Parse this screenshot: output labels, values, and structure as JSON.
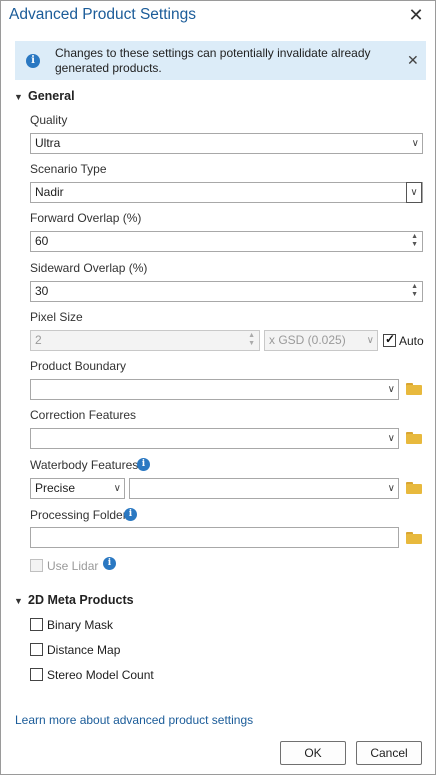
{
  "dialog": {
    "title": "Advanced Product Settings"
  },
  "banner": {
    "message": "Changes to these settings can potentially invalidate already generated products.",
    "icon": "info-icon"
  },
  "general": {
    "heading": "General",
    "quality": {
      "label": "Quality",
      "value": "Ultra"
    },
    "scenario": {
      "label": "Scenario Type",
      "value": "Nadir"
    },
    "forward_overlap": {
      "label": "Forward Overlap (%)",
      "value": "60"
    },
    "sideward_overlap": {
      "label": "Sideward Overlap (%)",
      "value": "30"
    },
    "pixel_size": {
      "label": "Pixel Size",
      "value": "2",
      "unit": "x GSD (0.025)",
      "auto_label": "Auto",
      "auto_checked": true
    },
    "product_boundary": {
      "label": "Product Boundary",
      "value": ""
    },
    "correction_features": {
      "label": "Correction Features",
      "value": ""
    },
    "waterbody_features": {
      "label": "Waterbody Features",
      "mode": "Precise",
      "value": ""
    },
    "processing_folder": {
      "label": "Processing Folder",
      "value": ""
    },
    "use_lidar": {
      "label": "Use Lidar",
      "checked": false
    }
  },
  "meta_products": {
    "heading": "2D Meta Products",
    "items": [
      {
        "label": "Binary Mask",
        "checked": false
      },
      {
        "label": "Distance Map",
        "checked": false
      },
      {
        "label": "Stereo Model Count",
        "checked": false
      }
    ]
  },
  "footer": {
    "link": "Learn more about advanced product settings",
    "ok_label": "OK",
    "cancel_label": "Cancel"
  },
  "colors": {
    "accent": "#1b5c99",
    "info_bg": "#dcecf8",
    "info_icon": "#2a78c2",
    "folder": "#e8b93d"
  }
}
